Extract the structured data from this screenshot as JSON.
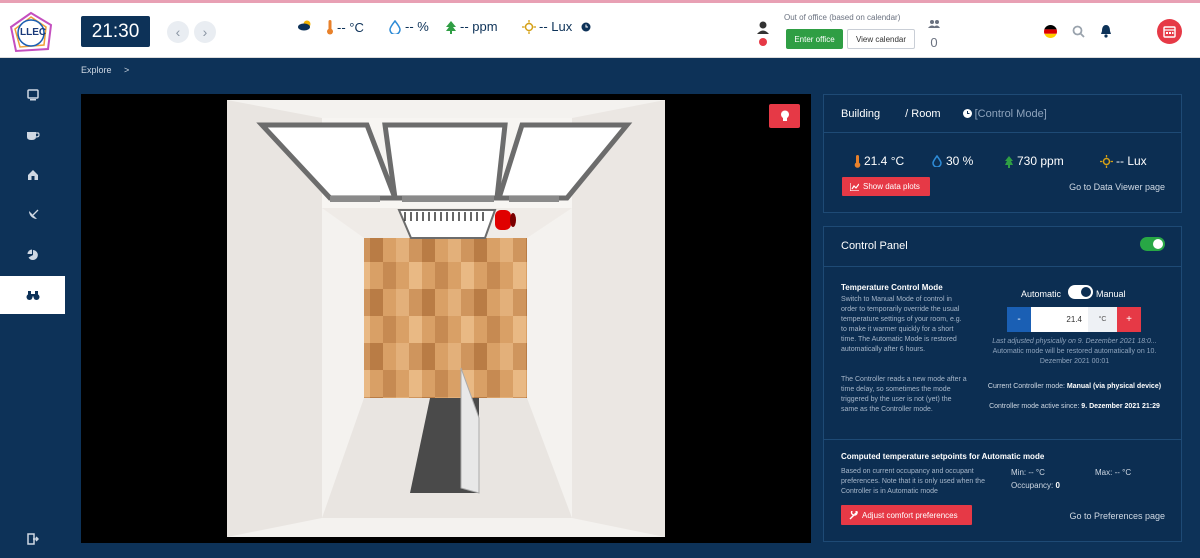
{
  "app": {
    "logo_text": "LLEC",
    "clock": "21:30"
  },
  "sensors": {
    "temperature": "-- °C",
    "humidity": "-- %",
    "co2": "-- ppm",
    "light": "-- Lux"
  },
  "office": {
    "status_label": "Out of office (based on calendar)",
    "enter_label": "Enter office",
    "view_calendar_label": "View calendar",
    "people_count": "0"
  },
  "breadcrumb": {
    "items": [
      "Explore",
      ">"
    ]
  },
  "room_info": {
    "building": "Building",
    "room": "/ Room",
    "mode": "[Control Mode]",
    "temperature": "21.4 °C",
    "humidity": "30 %",
    "co2": "730 ppm",
    "light": "-- Lux",
    "show_plots_label": "Show data plots",
    "data_viewer_link": "Go to Data Viewer page"
  },
  "control_panel": {
    "title": "Control Panel",
    "enabled": true,
    "temp_mode": {
      "title": "Temperature Control Mode",
      "desc_1": "Switch to Manual Mode of control in order to temporarily override the usual temperature settings of your room, e.g. to make it warmer quickly for a short time. The Automatic Mode is restored automatically after 6 hours.",
      "desc_2": "The Controller reads a new mode after a time delay, so sometimes the mode triggered by the user is not (yet) the same as the Controller mode.",
      "automatic_label": "Automatic",
      "manual_label": "Manual",
      "setpoint_value": "21.4",
      "setpoint_unit": "°C",
      "minus_label": "-",
      "plus_label": "+",
      "last_adjusted": "Last adjusted physically on 9. Dezember 2021 18:0...",
      "restore_note": "Automatic mode will be restored automatically on 10. Dezember 2021 00:01",
      "controller_mode_label": "Current Controller mode:",
      "controller_mode_value": "Manual (via physical device)",
      "active_since_label": "Controller mode active since:",
      "active_since_value": "9. Dezember 2021 21:29"
    },
    "setpoints": {
      "title": "Computed temperature setpoints for Automatic mode",
      "desc": "Based on current occupancy and occupant preferences. Note that it is only used when the Controller is in Automatic mode",
      "min_label": "Min:",
      "min_value": "-- °C",
      "max_label": "Max:",
      "max_value": "-- °C",
      "occupancy_label": "Occupancy:",
      "occupancy_value": "0",
      "adjust_label": "Adjust comfort preferences",
      "preferences_link": "Go to Preferences page"
    }
  },
  "colors": {
    "primary": "#0d3258",
    "accent_red": "#e63946",
    "green": "#2f9e44",
    "toggle_green": "#28a745"
  }
}
